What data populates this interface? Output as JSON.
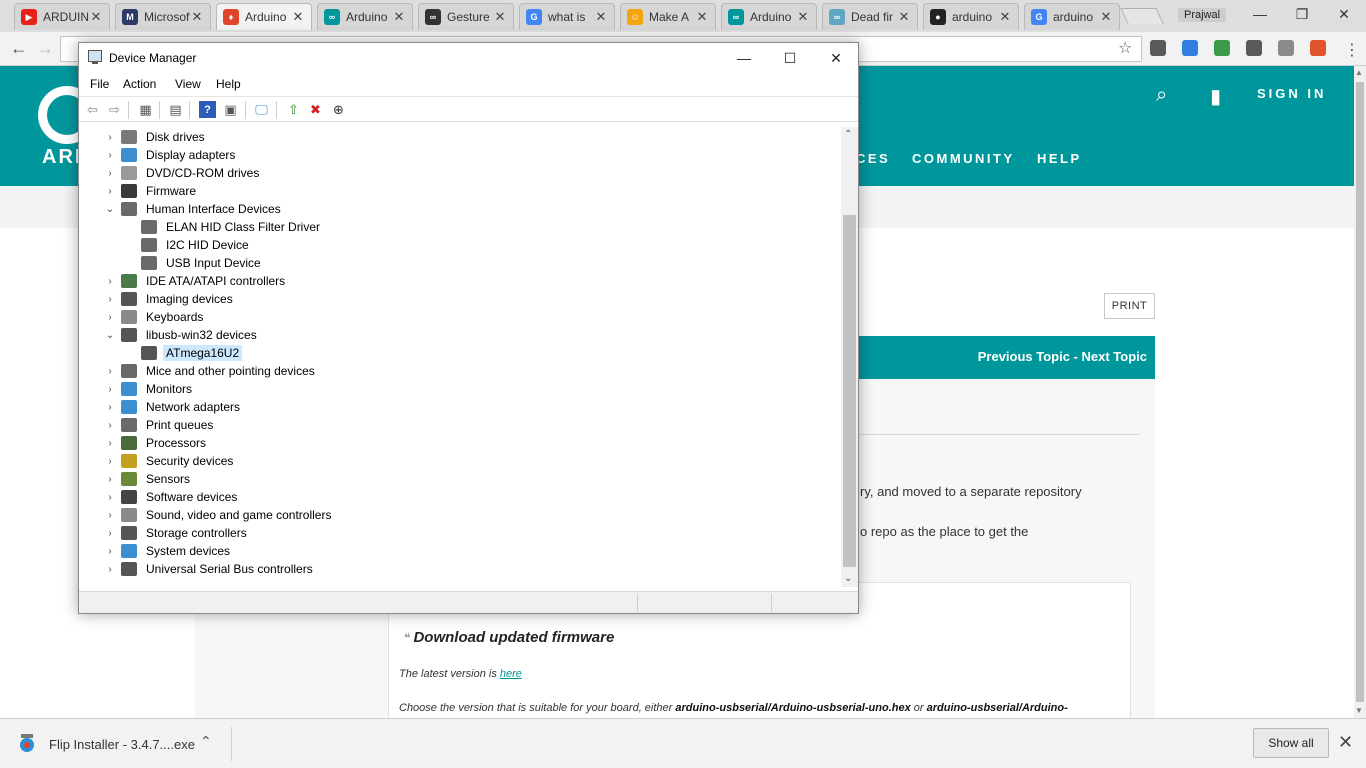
{
  "browser": {
    "tabs": [
      {
        "label": "ARDUINO",
        "icon": "youtube-icon",
        "color": "#e62117",
        "glyph": "▶"
      },
      {
        "label": "Microsoft",
        "icon": "microsoft-m-icon",
        "color": "#2b3a67",
        "glyph": "M"
      },
      {
        "label": "Arduino",
        "icon": "flame-icon",
        "color": "#e0452b",
        "glyph": "♦"
      },
      {
        "label": "Arduino",
        "icon": "arduino-icon",
        "color": "#00979c",
        "glyph": "∞"
      },
      {
        "label": "Gesture",
        "icon": "instructables-icon",
        "color": "#333333",
        "glyph": "∞"
      },
      {
        "label": "what is",
        "icon": "google-icon",
        "color": "#4285f4",
        "glyph": "G"
      },
      {
        "label": "Make A",
        "icon": "instructables-robot-icon",
        "color": "#f4a40c",
        "glyph": "☺"
      },
      {
        "label": "Arduino",
        "icon": "arduino-icon",
        "color": "#00979c",
        "glyph": "∞"
      },
      {
        "label": "Dead fir",
        "icon": "arduino-icon",
        "color": "#5fa7c2",
        "glyph": "∞"
      },
      {
        "label": "arduino",
        "icon": "github-icon",
        "color": "#222222",
        "glyph": "●"
      },
      {
        "label": "arduino",
        "icon": "google-icon",
        "color": "#4285f4",
        "glyph": "G"
      }
    ],
    "profile_name": "Prajwal",
    "extension_colors": [
      "#5a5a5a",
      "#2f7ee0",
      "#3a9a4a",
      "#5a5a5a",
      "#8a8a8a",
      "#e0542b"
    ]
  },
  "arduino_page": {
    "logo_text": "ARI",
    "signin": "SIGN IN",
    "nav": [
      "CES",
      "COMMUNITY",
      "HELP"
    ],
    "print": "PRINT",
    "topic_nav": "Previous Topic - Next Topic",
    "para1_tail": "ry, and moved to a separate repository",
    "para2_tail": "o repo as the place to get the",
    "firmware_title": "Download updated firmware",
    "latest_prefix": "The latest version is",
    "latest_link": "here",
    "choose_prefix": "Choose the version that is suitable for your board, either",
    "choose_file1": "arduino-usbserial/Arduino-usbserial-uno.hex",
    "choose_or": "or",
    "choose_file2": "arduino-usbserial/Arduino-"
  },
  "download_bar": {
    "file": "Flip Installer - 3.4.7....exe",
    "show_all": "Show all"
  },
  "device_manager": {
    "title": "Device Manager",
    "menus": [
      "File",
      "Action",
      "View",
      "Help"
    ],
    "tree": [
      {
        "label": "Disk drives",
        "level": 0,
        "expanded": false,
        "icon": "disk-drive-icon",
        "color": "#7a7a7a"
      },
      {
        "label": "Display adapters",
        "level": 0,
        "expanded": false,
        "icon": "display-adapter-icon",
        "color": "#3b8fd0"
      },
      {
        "label": "DVD/CD-ROM drives",
        "level": 0,
        "expanded": false,
        "icon": "dvd-drive-icon",
        "color": "#9a9a9a"
      },
      {
        "label": "Firmware",
        "level": 0,
        "expanded": false,
        "icon": "firmware-chip-icon",
        "color": "#3a3a3a"
      },
      {
        "label": "Human Interface Devices",
        "level": 0,
        "expanded": true,
        "icon": "hid-icon",
        "color": "#6a6a6a"
      },
      {
        "label": "ELAN HID Class Filter Driver",
        "level": 1,
        "expanded": null,
        "icon": "hid-icon",
        "color": "#6a6a6a"
      },
      {
        "label": "I2C HID Device",
        "level": 1,
        "expanded": null,
        "icon": "hid-icon",
        "color": "#6a6a6a"
      },
      {
        "label": "USB Input Device",
        "level": 1,
        "expanded": null,
        "icon": "hid-icon",
        "color": "#6a6a6a"
      },
      {
        "label": "IDE ATA/ATAPI controllers",
        "level": 0,
        "expanded": false,
        "icon": "ide-controller-icon",
        "color": "#4a7a4a"
      },
      {
        "label": "Imaging devices",
        "level": 0,
        "expanded": false,
        "icon": "camera-icon",
        "color": "#555555"
      },
      {
        "label": "Keyboards",
        "level": 0,
        "expanded": false,
        "icon": "keyboard-icon",
        "color": "#8a8a8a"
      },
      {
        "label": "libusb-win32 devices",
        "level": 0,
        "expanded": true,
        "icon": "usb-plug-icon",
        "color": "#555555"
      },
      {
        "label": "ATmega16U2",
        "level": 1,
        "expanded": null,
        "icon": "usb-plug-icon",
        "color": "#555555",
        "selected": true
      },
      {
        "label": "Mice and other pointing devices",
        "level": 0,
        "expanded": false,
        "icon": "mouse-icon",
        "color": "#6a6a6a"
      },
      {
        "label": "Monitors",
        "level": 0,
        "expanded": false,
        "icon": "monitor-icon",
        "color": "#3b8fd0"
      },
      {
        "label": "Network adapters",
        "level": 0,
        "expanded": false,
        "icon": "network-adapter-icon",
        "color": "#3b8fd0"
      },
      {
        "label": "Print queues",
        "level": 0,
        "expanded": false,
        "icon": "printer-icon",
        "color": "#6a6a6a"
      },
      {
        "label": "Processors",
        "level": 0,
        "expanded": false,
        "icon": "processor-icon",
        "color": "#4a6a3a"
      },
      {
        "label": "Security devices",
        "level": 0,
        "expanded": false,
        "icon": "security-key-icon",
        "color": "#c4a020"
      },
      {
        "label": "Sensors",
        "level": 0,
        "expanded": false,
        "icon": "sensor-icon",
        "color": "#6a8a3a"
      },
      {
        "label": "Software devices",
        "level": 0,
        "expanded": false,
        "icon": "software-device-icon",
        "color": "#444444"
      },
      {
        "label": "Sound, video and game controllers",
        "level": 0,
        "expanded": false,
        "icon": "speaker-icon",
        "color": "#8a8a8a"
      },
      {
        "label": "Storage controllers",
        "level": 0,
        "expanded": false,
        "icon": "storage-controller-icon",
        "color": "#555555"
      },
      {
        "label": "System devices",
        "level": 0,
        "expanded": false,
        "icon": "system-device-icon",
        "color": "#3b8fd0"
      },
      {
        "label": "Universal Serial Bus controllers",
        "level": 0,
        "expanded": false,
        "icon": "usb-plug-icon",
        "color": "#555555"
      }
    ]
  }
}
